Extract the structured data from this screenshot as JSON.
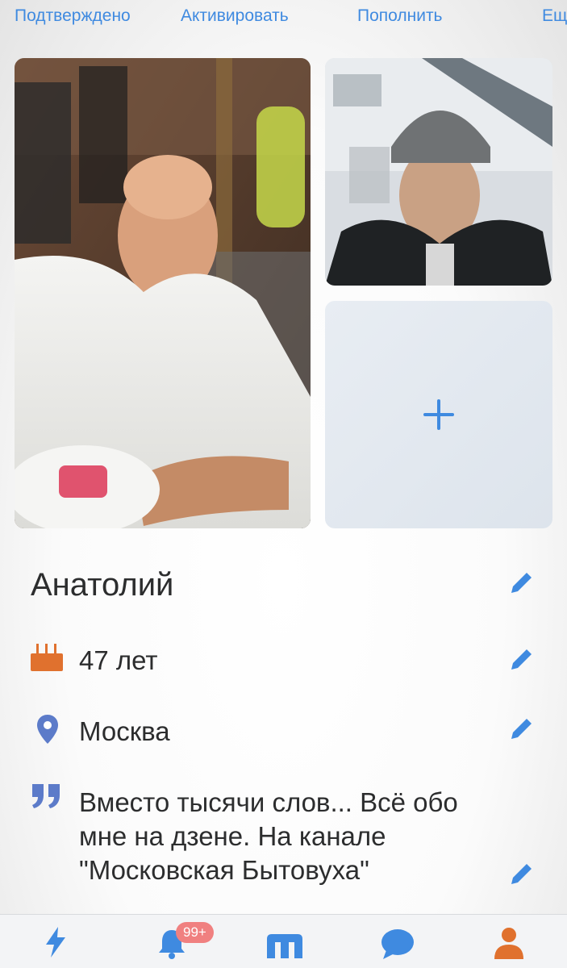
{
  "top_actions": {
    "confirmed": "Подтверждено",
    "activate": "Активировать",
    "top_up": "Пополнить",
    "more": "Ещё"
  },
  "profile": {
    "name": "Анатолий",
    "age": "47 лет",
    "city": "Москва",
    "about": "Вместо тысячи слов... Всё обо мне на дзене. На канале \"Московская Бытовуха\""
  },
  "tabbar": {
    "notifications_badge": "99+",
    "tabs": [
      "lightning-icon",
      "bell-icon",
      "m-logo-icon",
      "chat-icon",
      "profile-icon"
    ]
  },
  "colors": {
    "accent": "#3f8ae0",
    "badge": "#f08080",
    "location_pin": "#5c7bc9",
    "cake": "#e0712e",
    "profile_tab": "#e0712e"
  }
}
